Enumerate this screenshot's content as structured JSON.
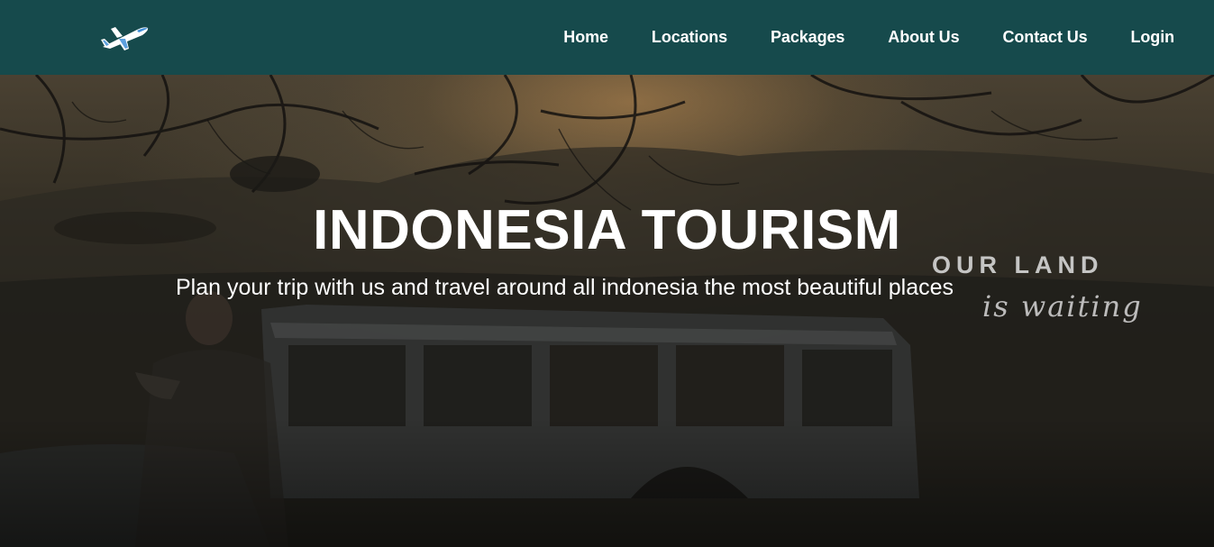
{
  "navbar": {
    "logo_icon": "airplane-icon",
    "links": [
      {
        "label": "Home"
      },
      {
        "label": "Locations"
      },
      {
        "label": "Packages"
      },
      {
        "label": "About Us"
      },
      {
        "label": "Contact Us"
      },
      {
        "label": "Login"
      }
    ]
  },
  "hero": {
    "title": "INDONESIA TOURISM",
    "subtitle": "Plan your trip with us and travel around all indonesia the most beautiful places",
    "background_overlay_line1": "OUR LAND",
    "background_overlay_line2": "is waiting"
  },
  "colors": {
    "navbar_bg": "#164a4c",
    "nav_text": "#ffffff",
    "hero_text": "#ffffff"
  }
}
